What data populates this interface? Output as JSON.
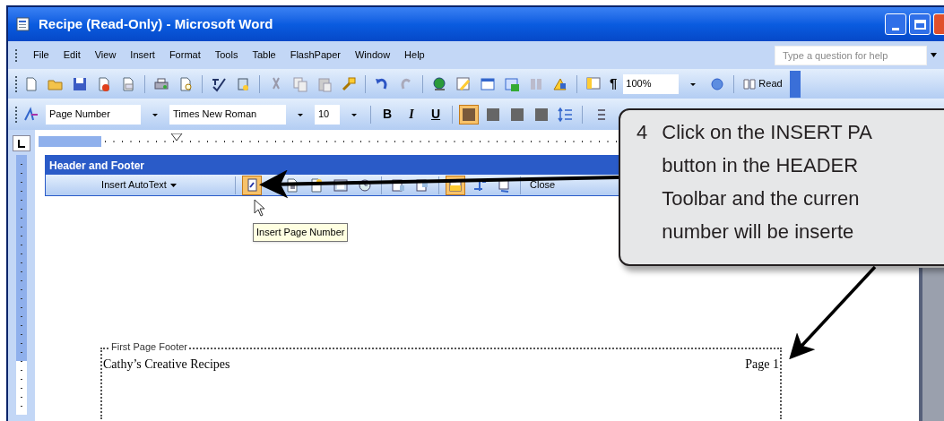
{
  "window": {
    "title": "Recipe (Read-Only) - Microsoft Word"
  },
  "menu": [
    {
      "label": "File"
    },
    {
      "label": "Edit"
    },
    {
      "label": "View"
    },
    {
      "label": "Insert"
    },
    {
      "label": "Format"
    },
    {
      "label": "Tools"
    },
    {
      "label": "Table"
    },
    {
      "label": "FlashPaper"
    },
    {
      "label": "Window"
    },
    {
      "label": "Help"
    }
  ],
  "help_box": {
    "placeholder": "Type a question for help"
  },
  "standard_toolbar": {
    "show_formatting": "¶",
    "zoom": "100%",
    "read_button": "Read"
  },
  "formatting_toolbar": {
    "style": "Page Number",
    "font": "Times New Roman",
    "size": "10",
    "bold": "B",
    "italic": "I",
    "underline": "U",
    "alignments": [
      {
        "selected": true
      },
      {
        "selected": false
      },
      {
        "selected": false
      },
      {
        "selected": false
      }
    ]
  },
  "header_footer_toolbar": {
    "title": "Header and Footer",
    "insert_autotext": "Insert AutoText",
    "close": "Close",
    "buttons": [
      {
        "selected": true
      },
      {
        "selected": false
      },
      {
        "selected": false
      },
      {
        "selected": false
      },
      {
        "selected": false
      },
      {
        "selected": false
      },
      {
        "selected": false
      },
      {
        "selected": true
      },
      {
        "selected": false
      },
      {
        "selected": false
      }
    ]
  },
  "tooltip": "Insert Page Number",
  "document": {
    "footer_label": "First Page Footer",
    "footer_left": "Cathy’s Creative Recipes",
    "footer_right": "Page 1"
  },
  "callout": {
    "number": "4",
    "lines": [
      "Click on the INSERT PA",
      "button in the HEADER",
      "Toolbar and the curren",
      "number will be inserte"
    ]
  }
}
